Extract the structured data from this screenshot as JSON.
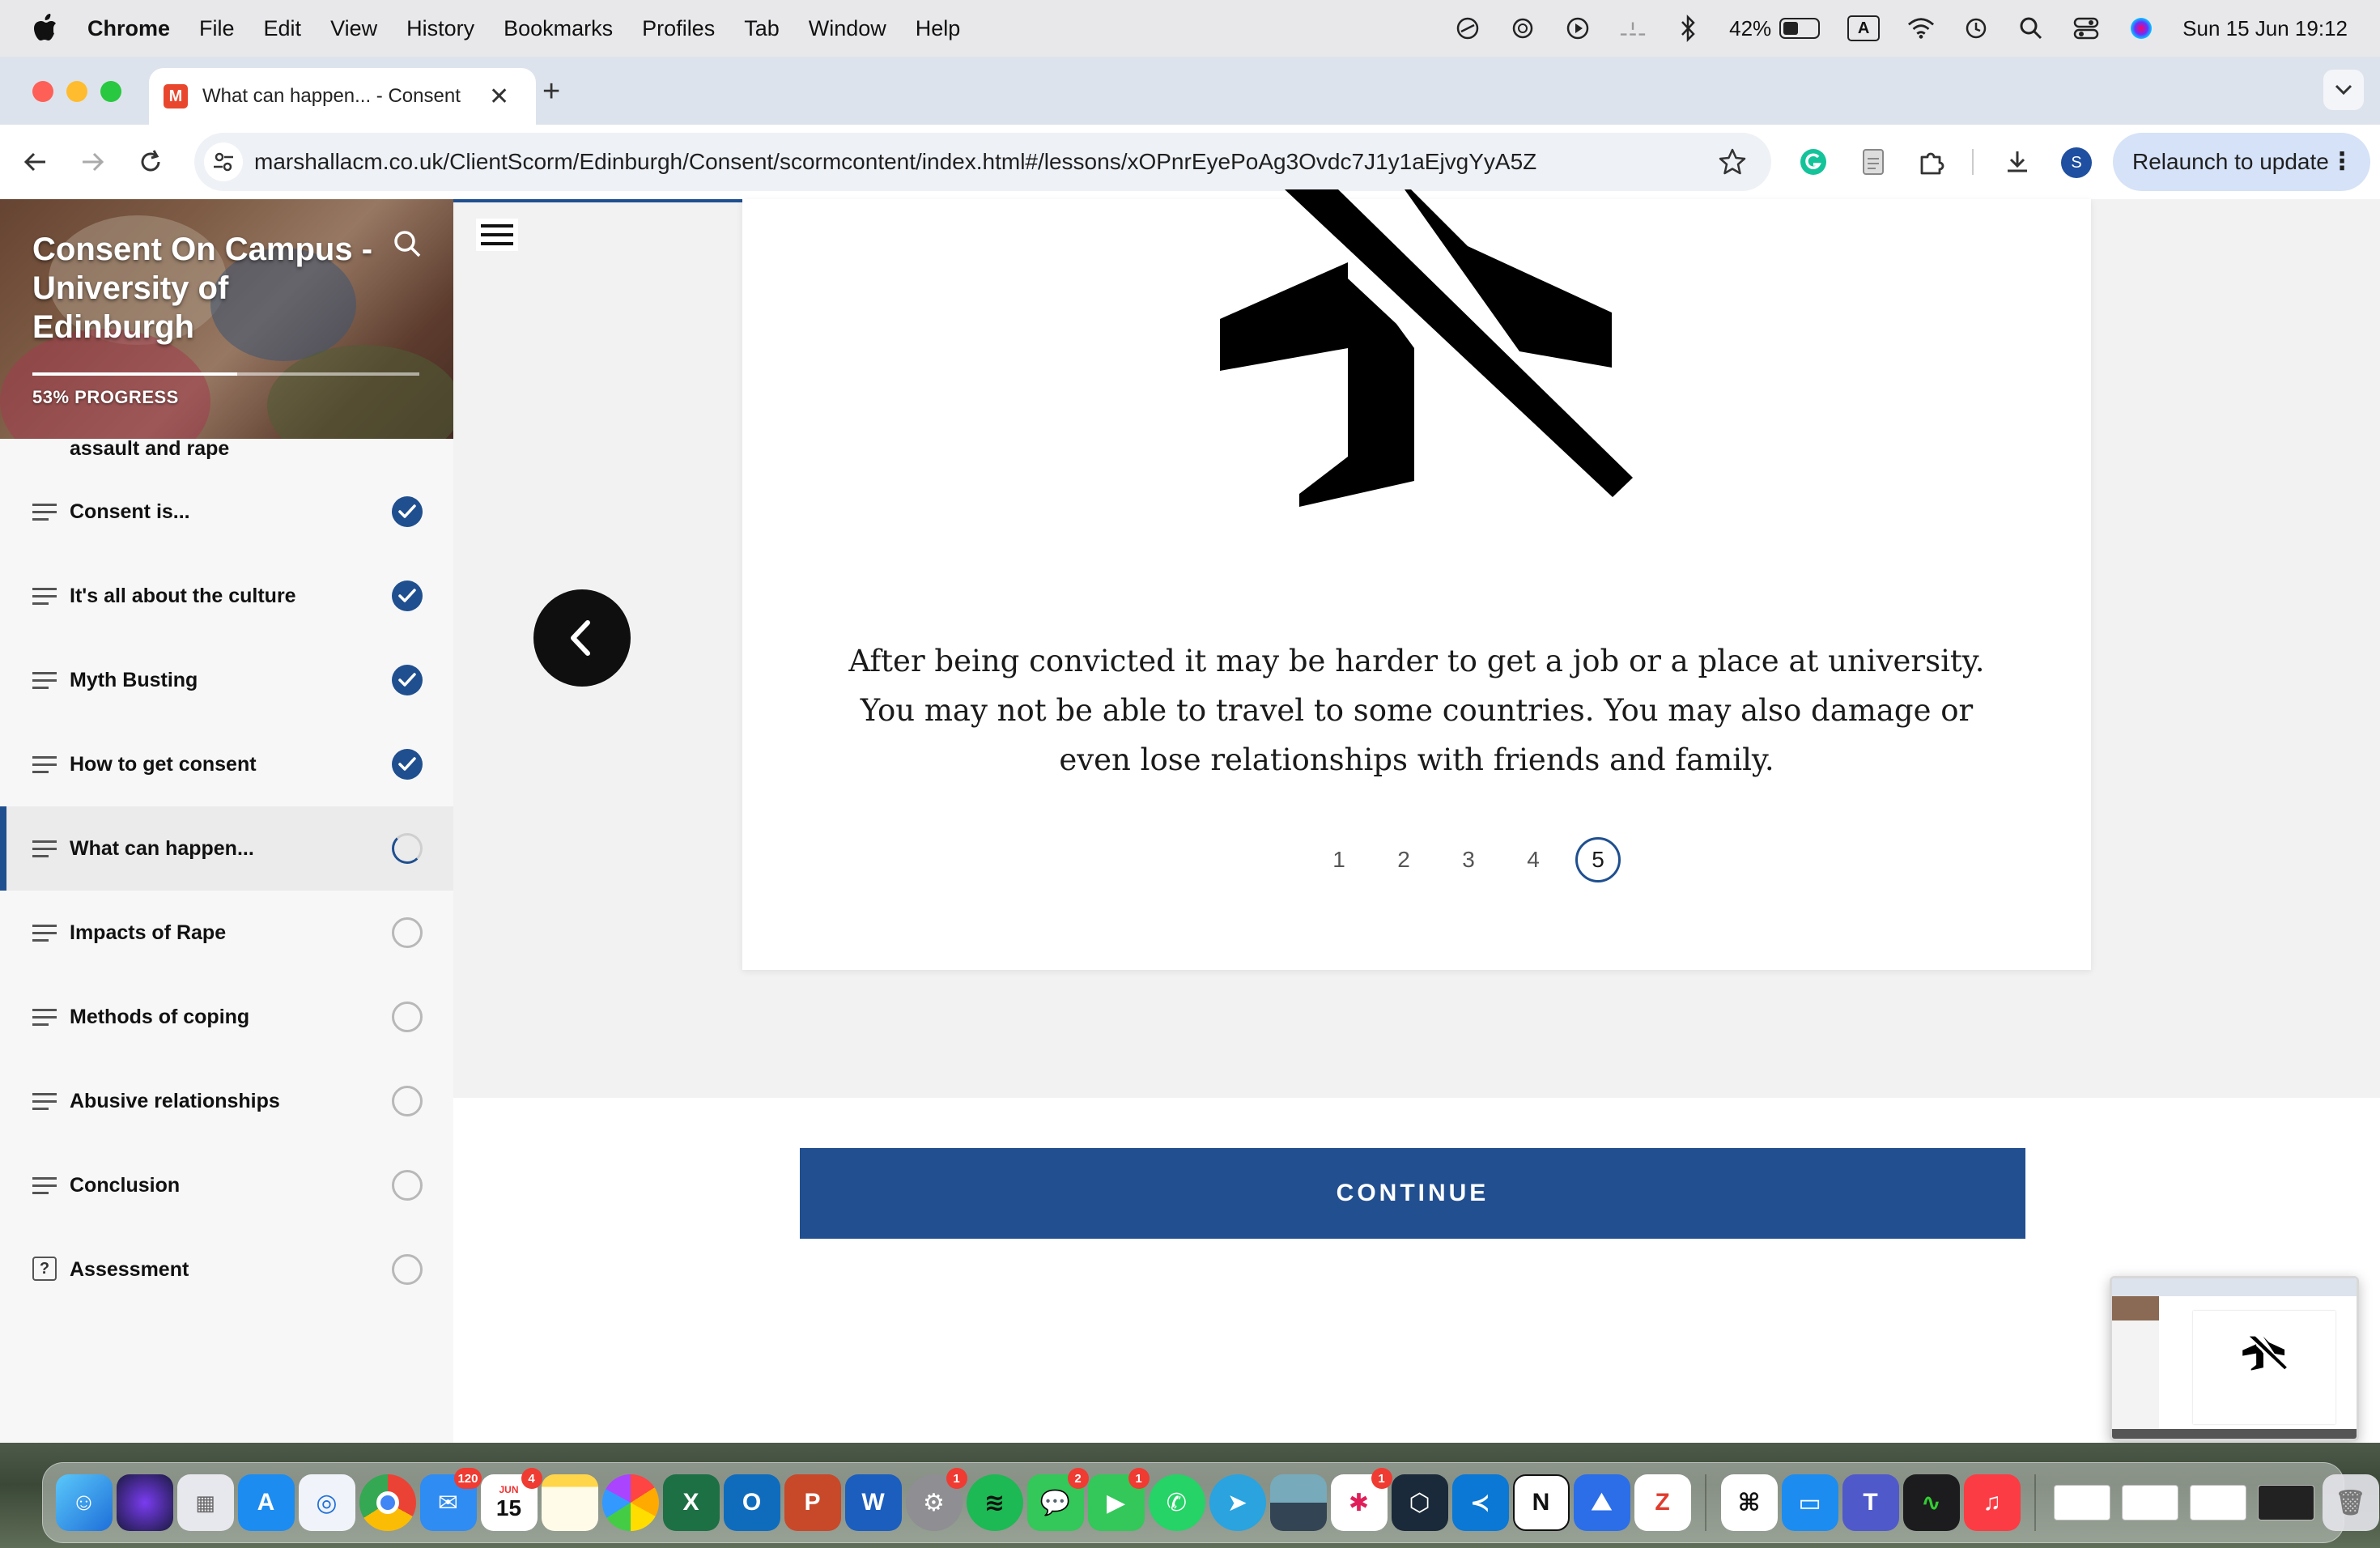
{
  "menubar": {
    "app_name": "Chrome",
    "menus": [
      "File",
      "Edit",
      "View",
      "History",
      "Bookmarks",
      "Profiles",
      "Tab",
      "Window",
      "Help"
    ],
    "battery_percent": "42%",
    "input_indicator": "A",
    "datetime": "Sun 15 Jun  19:12"
  },
  "browser": {
    "tab_title": "What can happen... - Consent",
    "tab_favicon_letter": "M",
    "url": "marshallacm.co.uk/ClientScorm/Edinburgh/Consent/scormcontent/index.html#/lessons/xOPnrEyePoAg3Ovdc7J1y1aEjvgYyA5Z",
    "profile_initial": "S",
    "relaunch_label": "Relaunch to update",
    "accent_color": "#d5e2f7"
  },
  "course": {
    "title": "Consent On Campus - University of Edinburgh",
    "progress_label": "53% PROGRESS",
    "progress_fraction": 0.53,
    "partial_item_label": "assault and rape",
    "lessons": [
      {
        "label": "Consent is...",
        "status": "done",
        "icon": "lines-icon"
      },
      {
        "label": "It's all about the culture",
        "status": "done",
        "icon": "lines-icon"
      },
      {
        "label": "Myth Busting",
        "status": "done",
        "icon": "lines-icon"
      },
      {
        "label": "How to get consent",
        "status": "done",
        "icon": "lines-icon"
      },
      {
        "label": "What can happen...",
        "status": "in-progress",
        "icon": "lines-icon"
      },
      {
        "label": "Impacts of Rape",
        "status": "not-started",
        "icon": "lines-icon"
      },
      {
        "label": "Methods of coping",
        "status": "not-started",
        "icon": "lines-icon"
      },
      {
        "label": "Abusive relationships",
        "status": "not-started",
        "icon": "lines-icon"
      },
      {
        "label": "Conclusion",
        "status": "not-started",
        "icon": "lines-icon"
      },
      {
        "label": "Assessment",
        "status": "not-started",
        "icon": "quiz-icon"
      }
    ],
    "brand_color": "#224f8f"
  },
  "lesson": {
    "card_icon": "airplane-off-icon",
    "card_text": "After being convicted it may be harder to get a job or a place at university. You may not be able to travel to some countries. You may also damage or even lose relationships with friends and family.",
    "pages": [
      "1",
      "2",
      "3",
      "4",
      "5"
    ],
    "current_page": "5",
    "continue_label": "CONTINUE"
  },
  "dock": {
    "mail_badge": "120",
    "calendar_month": "JUN",
    "calendar_day": "15",
    "calendar_badge": "4",
    "settings_badge": "1",
    "messages_badge": "2",
    "facetime_badge": "1",
    "slack_badge": "1"
  }
}
